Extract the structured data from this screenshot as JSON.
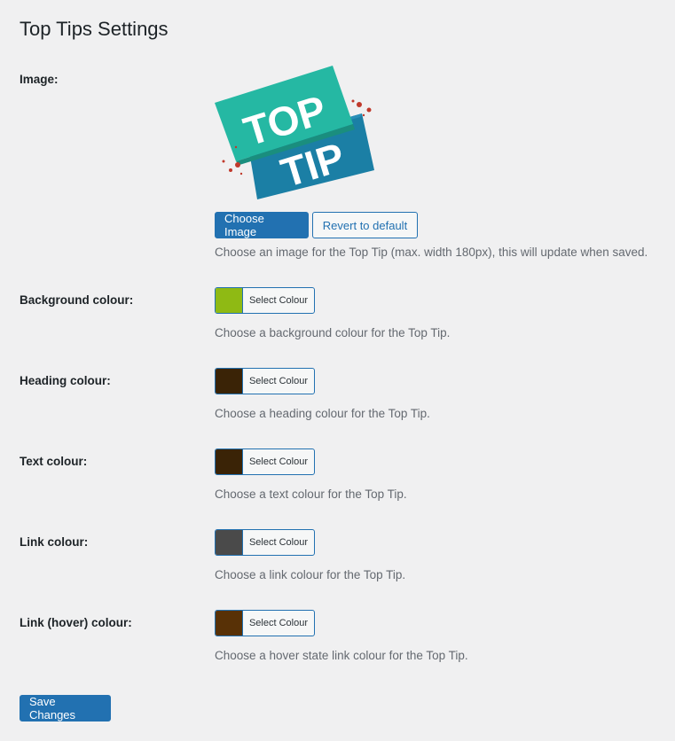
{
  "page": {
    "title": "Top Tips Settings"
  },
  "image_setting": {
    "label": "Image:",
    "logo_text_top": "TOP",
    "logo_text_bottom": "TIP",
    "choose_button": "Choose Image",
    "revert_button": "Revert to default",
    "description": "Choose an image for the Top Tip (max. width 180px), this will update when saved.",
    "logo_colors": {
      "top_panel": "#25b8a3",
      "bottom_panel": "#1b7fa5",
      "dots": "#c0392b"
    }
  },
  "colour_settings": [
    {
      "label": "Background colour:",
      "button": "Select Colour",
      "swatch": "#8fba14",
      "description": "Choose a background colour for the Top Tip."
    },
    {
      "label": "Heading colour:",
      "button": "Select Colour",
      "swatch": "#3a2306",
      "description": "Choose a heading colour for the Top Tip."
    },
    {
      "label": "Text colour:",
      "button": "Select Colour",
      "swatch": "#3a2306",
      "description": "Choose a text colour for the Top Tip."
    },
    {
      "label": "Link colour:",
      "button": "Select Colour",
      "swatch": "#4a4a4a",
      "description": "Choose a link colour for the Top Tip."
    },
    {
      "label": "Link (hover) colour:",
      "button": "Select Colour",
      "swatch": "#583106",
      "description": "Choose a hover state link colour for the Top Tip."
    }
  ],
  "save_button": "Save Changes",
  "accent_color": "#2271b1"
}
